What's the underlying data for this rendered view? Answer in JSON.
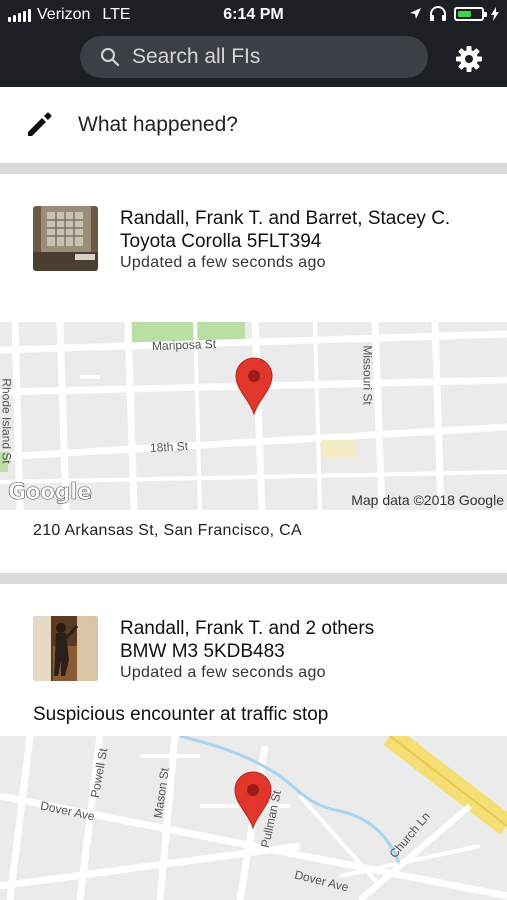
{
  "status_bar": {
    "carrier": "Verizon",
    "network": "LTE",
    "time": "6:14 PM"
  },
  "search": {
    "placeholder": "Search all FIs",
    "icon": "search-icon"
  },
  "settings": {
    "icon": "gear-icon"
  },
  "composer": {
    "prompt": "What happened?",
    "icon": "pencil-icon"
  },
  "cards": [
    {
      "names": "Randall, Frank T. and Barret, Stacey C.",
      "vehicle": "Toyota Corolla 5FLT394",
      "updated": "Updated a few seconds ago",
      "map": {
        "streets": [
          "Mariposa St",
          "Missouri St",
          "Rhode Island St",
          "18th St"
        ],
        "attribution": "Map data ©2018 Google",
        "logo": "Google"
      },
      "address": "210 Arkansas St, San Francisco, CA"
    },
    {
      "names": "Randall, Frank T. and 2 others",
      "vehicle": "BMW M3 5KDB483",
      "updated": "Updated a few seconds ago",
      "description": "Suspicious encounter at traffic stop",
      "map": {
        "streets": [
          "Powell St",
          "Mason St",
          "Dover Ave",
          "Pullman St",
          "Church Ln",
          "Dover Ave"
        ]
      }
    }
  ],
  "colors": {
    "header_bg": "#1c1f24",
    "search_bg": "#3b3f46",
    "divider": "#d9d9d9",
    "pin": "#e0362c",
    "battery": "#3fd24a"
  }
}
